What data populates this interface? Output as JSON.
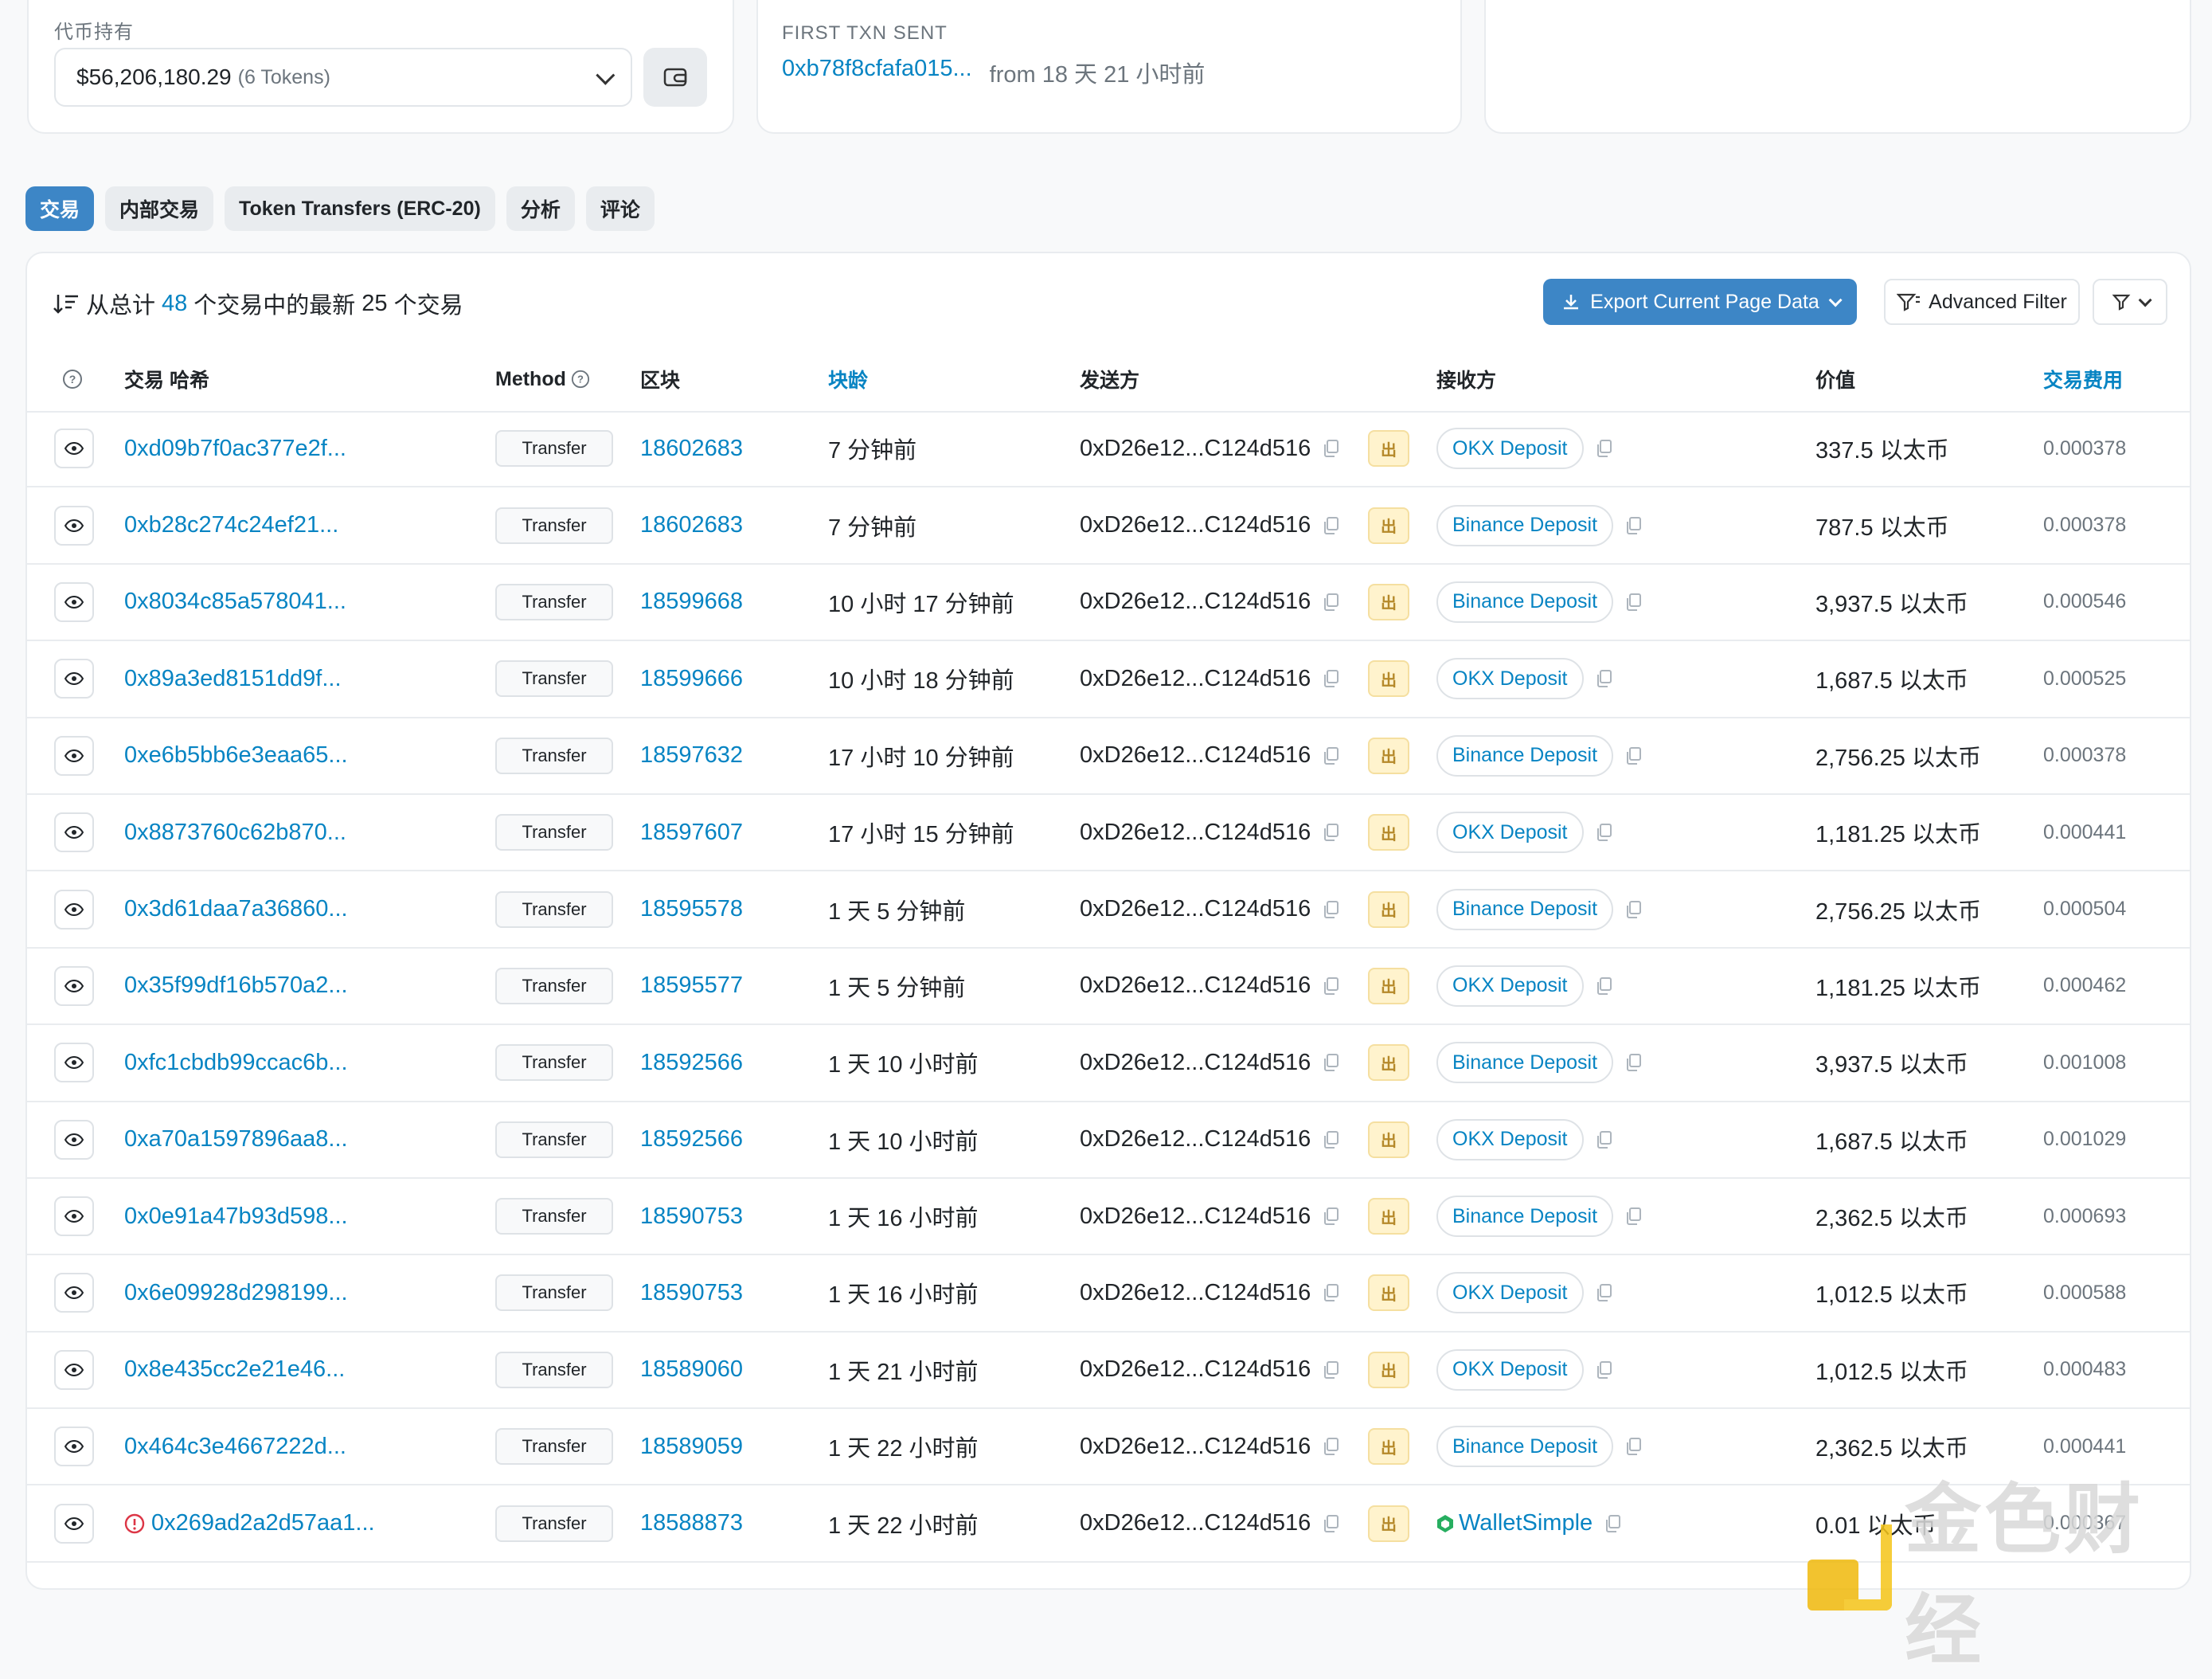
{
  "holdings": {
    "label": "代币持有",
    "value": "$56,206,180.29",
    "sub": "(6 Tokens)"
  },
  "first_txn": {
    "label": "FIRST TXN SENT",
    "hash": "0xb78f8cfafa015...",
    "from_text": "from 18 天 21 小时前"
  },
  "tabs": [
    {
      "label": "交易",
      "active": true
    },
    {
      "label": "内部交易"
    },
    {
      "label": "Token Transfers (ERC-20)"
    },
    {
      "label": "分析"
    },
    {
      "label": "评论"
    }
  ],
  "summary": {
    "prefix": "从总计",
    "total": "48",
    "middle": "个交易中的最新",
    "count": "25",
    "suffix": "个交易"
  },
  "toolbar": {
    "export_label": "Export Current Page Data",
    "advanced_filter_label": "Advanced Filter"
  },
  "headers": {
    "hash": "交易 哈希",
    "method": "Method",
    "block": "区块",
    "age": "块龄",
    "from": "发送方",
    "to": "接收方",
    "value": "价值",
    "fee": "交易费用"
  },
  "out_label": "出",
  "rows": [
    {
      "hash": "0xd09b7f0ac377e2f...",
      "method": "Transfer",
      "block": "18602683",
      "age": "7 分钟前",
      "from": "0xD26e12...C124d516",
      "to": "OKX Deposit",
      "value": "337.5 以太币",
      "fee": "0.000378"
    },
    {
      "hash": "0xb28c274c24ef21...",
      "method": "Transfer",
      "block": "18602683",
      "age": "7 分钟前",
      "from": "0xD26e12...C124d516",
      "to": "Binance Deposit",
      "value": "787.5 以太币",
      "fee": "0.000378"
    },
    {
      "hash": "0x8034c85a578041...",
      "method": "Transfer",
      "block": "18599668",
      "age": "10 小时 17 分钟前",
      "from": "0xD26e12...C124d516",
      "to": "Binance Deposit",
      "value": "3,937.5 以太币",
      "fee": "0.000546"
    },
    {
      "hash": "0x89a3ed8151dd9f...",
      "method": "Transfer",
      "block": "18599666",
      "age": "10 小时 18 分钟前",
      "from": "0xD26e12...C124d516",
      "to": "OKX Deposit",
      "value": "1,687.5 以太币",
      "fee": "0.000525"
    },
    {
      "hash": "0xe6b5bb6e3eaa65...",
      "method": "Transfer",
      "block": "18597632",
      "age": "17 小时 10 分钟前",
      "from": "0xD26e12...C124d516",
      "to": "Binance Deposit",
      "value": "2,756.25 以太币",
      "fee": "0.000378"
    },
    {
      "hash": "0x8873760c62b870...",
      "method": "Transfer",
      "block": "18597607",
      "age": "17 小时 15 分钟前",
      "from": "0xD26e12...C124d516",
      "to": "OKX Deposit",
      "value": "1,181.25 以太币",
      "fee": "0.000441"
    },
    {
      "hash": "0x3d61daa7a36860...",
      "method": "Transfer",
      "block": "18595578",
      "age": "1 天 5 分钟前",
      "from": "0xD26e12...C124d516",
      "to": "Binance Deposit",
      "value": "2,756.25 以太币",
      "fee": "0.000504"
    },
    {
      "hash": "0x35f99df16b570a2...",
      "method": "Transfer",
      "block": "18595577",
      "age": "1 天 5 分钟前",
      "from": "0xD26e12...C124d516",
      "to": "OKX Deposit",
      "value": "1,181.25 以太币",
      "fee": "0.000462"
    },
    {
      "hash": "0xfc1cbdb99ccac6b...",
      "method": "Transfer",
      "block": "18592566",
      "age": "1 天 10 小时前",
      "from": "0xD26e12...C124d516",
      "to": "Binance Deposit",
      "value": "3,937.5 以太币",
      "fee": "0.001008"
    },
    {
      "hash": "0xa70a1597896aa8...",
      "method": "Transfer",
      "block": "18592566",
      "age": "1 天 10 小时前",
      "from": "0xD26e12...C124d516",
      "to": "OKX Deposit",
      "value": "1,687.5 以太币",
      "fee": "0.001029"
    },
    {
      "hash": "0x0e91a47b93d598...",
      "method": "Transfer",
      "block": "18590753",
      "age": "1 天 16 小时前",
      "from": "0xD26e12...C124d516",
      "to": "Binance Deposit",
      "value": "2,362.5 以太币",
      "fee": "0.000693"
    },
    {
      "hash": "0x6e09928d298199...",
      "method": "Transfer",
      "block": "18590753",
      "age": "1 天 16 小时前",
      "from": "0xD26e12...C124d516",
      "to": "OKX Deposit",
      "value": "1,012.5 以太币",
      "fee": "0.000588"
    },
    {
      "hash": "0x8e435cc2e21e46...",
      "method": "Transfer",
      "block": "18589060",
      "age": "1 天 21 小时前",
      "from": "0xD26e12...C124d516",
      "to": "OKX Deposit",
      "value": "1,012.5 以太币",
      "fee": "0.000483"
    },
    {
      "hash": "0x464c3e4667222d...",
      "method": "Transfer",
      "block": "18589059",
      "age": "1 天 22 小时前",
      "from": "0xD26e12...C124d516",
      "to": "Binance Deposit",
      "value": "2,362.5 以太币",
      "fee": "0.000441"
    },
    {
      "hash": "0x269ad2a2d57aa1...",
      "method": "Transfer",
      "block": "18588873",
      "age": "1 天 22 小时前",
      "from": "0xD26e12...C124d516",
      "to": "WalletSimple",
      "to_plain": true,
      "error": true,
      "value": "0.01 以太币",
      "fee": "0.000367"
    }
  ],
  "watermark": "金色财经",
  "colors": {
    "link": "#0784c3",
    "accent": "#3d86c6",
    "out_badge": "#fff3cd",
    "error": "#dc3545",
    "contract_icon": "#27ae60"
  },
  "icons": {
    "eye": "eye-icon",
    "copy": "copy-icon",
    "wallet": "wallet-icon",
    "filter": "filter-icon",
    "download": "download-icon",
    "sort": "sort-icon",
    "help": "help-circle-icon",
    "error": "alert-circle-icon",
    "contract": "contract-icon"
  }
}
